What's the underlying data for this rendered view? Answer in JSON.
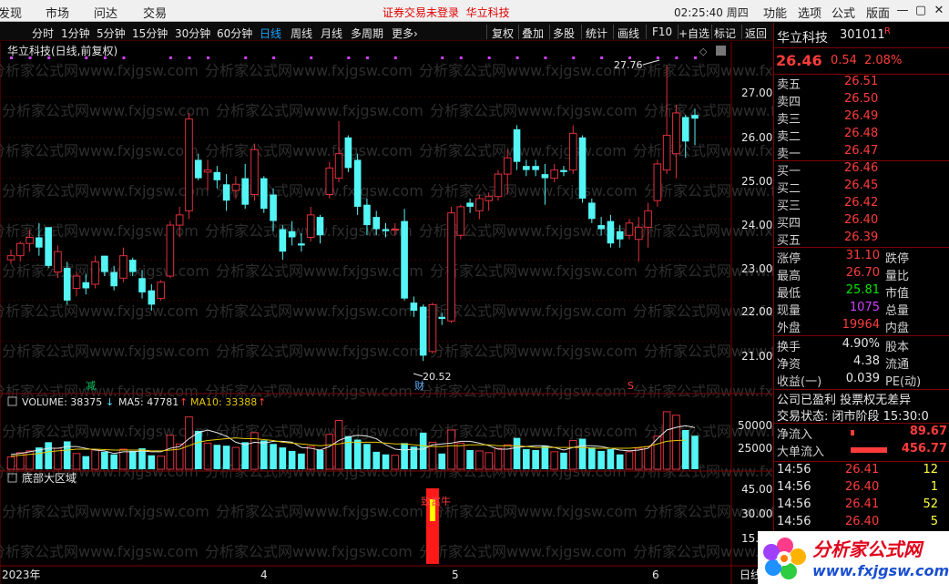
{
  "menu": {
    "items": [
      "发现",
      "市场",
      "问达",
      "交易"
    ],
    "status_text": "证券交易未登录",
    "status_stock": "华立科技",
    "clock": "02:25:40 周四",
    "right": [
      "功能",
      "选项",
      "公式",
      "版面"
    ],
    "window_controls": [
      "—",
      "▢",
      "✕"
    ]
  },
  "toolbar": {
    "timeframes": [
      "分时",
      "1分钟",
      "5分钟",
      "15分钟",
      "30分钟",
      "60分钟",
      "日线",
      "周线",
      "月线",
      "多周期",
      "更多›"
    ],
    "active": "日线",
    "buttons": [
      "复权",
      "叠加",
      "多股",
      "统计",
      "画线",
      "F10",
      "+自选",
      "标记",
      "返回"
    ]
  },
  "chart": {
    "title": "华立科技(日线,前复权)",
    "price_ticks": [
      "27.00",
      "26.00",
      "25.00",
      "24.00",
      "23.00",
      "22.00",
      "21.00"
    ],
    "high_label": "27.76",
    "low_label": "20.52",
    "mark_jian": "减",
    "mark_cai": "财",
    "mark_s": "S",
    "volume_label": "VOLUME: 38375",
    "ma5_label": "MA5: 47781",
    "ma10_label": "MA10: 33388",
    "volume_ticks": [
      "50000",
      "25000"
    ],
    "indicator_title": "底部大区域",
    "indicator_ticks": [
      "45.00",
      "30.00",
      "15.00"
    ],
    "indicator_signal": "致富牛",
    "date_labels": [
      "2023年",
      "4",
      "5",
      "6"
    ],
    "date_right": "日线",
    "watermark": "分析家公式网www.fxjgsw.com",
    "colors": {
      "up": "#e0303c",
      "down": "#54f5f5",
      "ma5": "#e6e6e6",
      "ma10": "#e6c800",
      "border": "#800000"
    }
  },
  "chart_data": {
    "type": "candlestick",
    "title": "华立科技(日线,前复权)",
    "ylim": [
      20.3,
      27.85
    ],
    "candles": [
      {
        "o": 23.0,
        "h": 23.25,
        "l": 22.9,
        "c": 23.1,
        "v": 14000
      },
      {
        "o": 23.1,
        "h": 23.45,
        "l": 22.95,
        "c": 23.4,
        "v": 19000
      },
      {
        "o": 23.4,
        "h": 23.75,
        "l": 23.2,
        "c": 23.55,
        "v": 21000
      },
      {
        "o": 23.55,
        "h": 23.9,
        "l": 23.1,
        "c": 23.3,
        "v": 25000
      },
      {
        "o": 23.8,
        "h": 23.8,
        "l": 22.8,
        "c": 22.85,
        "v": 31000
      },
      {
        "o": 22.7,
        "h": 23.35,
        "l": 22.55,
        "c": 23.2,
        "v": 24000
      },
      {
        "o": 22.8,
        "h": 22.95,
        "l": 21.9,
        "c": 22.0,
        "v": 32000
      },
      {
        "o": 22.3,
        "h": 22.7,
        "l": 22.1,
        "c": 22.6,
        "v": 18000
      },
      {
        "o": 22.45,
        "h": 22.65,
        "l": 22.15,
        "c": 22.3,
        "v": 15000
      },
      {
        "o": 22.4,
        "h": 23.1,
        "l": 22.3,
        "c": 22.95,
        "v": 22000
      },
      {
        "o": 23.1,
        "h": 23.1,
        "l": 22.6,
        "c": 22.7,
        "v": 20000
      },
      {
        "o": 22.7,
        "h": 22.85,
        "l": 22.25,
        "c": 22.35,
        "v": 17000
      },
      {
        "o": 22.55,
        "h": 23.3,
        "l": 22.45,
        "c": 23.1,
        "v": 23000
      },
      {
        "o": 23.0,
        "h": 23.05,
        "l": 22.6,
        "c": 22.7,
        "v": 21000
      },
      {
        "o": 22.55,
        "h": 22.75,
        "l": 22.05,
        "c": 22.2,
        "v": 24000
      },
      {
        "o": 22.25,
        "h": 22.4,
        "l": 21.75,
        "c": 21.9,
        "v": 16000
      },
      {
        "o": 22.05,
        "h": 22.5,
        "l": 22.0,
        "c": 22.45,
        "v": 15000
      },
      {
        "o": 22.6,
        "h": 23.95,
        "l": 22.55,
        "c": 23.85,
        "v": 39000
      },
      {
        "o": 23.85,
        "h": 24.3,
        "l": 23.55,
        "c": 24.1,
        "v": 29000
      },
      {
        "o": 24.2,
        "h": 26.6,
        "l": 24.0,
        "c": 26.45,
        "v": 60000
      },
      {
        "o": 25.45,
        "h": 25.6,
        "l": 24.95,
        "c": 25.0,
        "v": 44000
      },
      {
        "o": 25.15,
        "h": 25.45,
        "l": 24.7,
        "c": 25.2,
        "v": 30000
      },
      {
        "o": 25.15,
        "h": 25.3,
        "l": 24.75,
        "c": 24.95,
        "v": 28000
      },
      {
        "o": 24.85,
        "h": 25.1,
        "l": 24.2,
        "c": 24.45,
        "v": 27000
      },
      {
        "o": 24.7,
        "h": 25.05,
        "l": 24.5,
        "c": 24.85,
        "v": 25000
      },
      {
        "o": 25.0,
        "h": 25.35,
        "l": 24.25,
        "c": 24.35,
        "v": 31000
      },
      {
        "o": 24.6,
        "h": 25.85,
        "l": 24.45,
        "c": 25.7,
        "v": 42000
      },
      {
        "o": 25.0,
        "h": 25.05,
        "l": 24.15,
        "c": 24.25,
        "v": 33000
      },
      {
        "o": 24.6,
        "h": 24.75,
        "l": 23.7,
        "c": 23.95,
        "v": 29000
      },
      {
        "o": 23.75,
        "h": 23.85,
        "l": 23.0,
        "c": 23.2,
        "v": 25000
      },
      {
        "o": 23.7,
        "h": 23.95,
        "l": 23.35,
        "c": 23.55,
        "v": 21000
      },
      {
        "o": 23.4,
        "h": 23.65,
        "l": 23.2,
        "c": 23.35,
        "v": 18000
      },
      {
        "o": 23.55,
        "h": 24.3,
        "l": 23.45,
        "c": 24.1,
        "v": 26000
      },
      {
        "o": 24.05,
        "h": 24.1,
        "l": 23.4,
        "c": 23.6,
        "v": 22000
      },
      {
        "o": 24.6,
        "h": 25.4,
        "l": 24.5,
        "c": 25.25,
        "v": 40000
      },
      {
        "o": 25.0,
        "h": 26.4,
        "l": 24.9,
        "c": 25.6,
        "v": 56000
      },
      {
        "o": 26.0,
        "h": 26.05,
        "l": 25.15,
        "c": 25.25,
        "v": 38000
      },
      {
        "o": 25.45,
        "h": 25.6,
        "l": 24.1,
        "c": 24.3,
        "v": 34000
      },
      {
        "o": 24.35,
        "h": 24.5,
        "l": 23.6,
        "c": 23.85,
        "v": 29000
      },
      {
        "o": 24.05,
        "h": 24.2,
        "l": 23.6,
        "c": 23.75,
        "v": 20000
      },
      {
        "o": 23.75,
        "h": 23.9,
        "l": 23.55,
        "c": 23.7,
        "v": 17000
      },
      {
        "o": 23.75,
        "h": 23.9,
        "l": 23.6,
        "c": 23.75,
        "v": 16000
      },
      {
        "o": 23.95,
        "h": 24.25,
        "l": 22.0,
        "c": 22.05,
        "v": 30000
      },
      {
        "o": 21.95,
        "h": 22.1,
        "l": 21.6,
        "c": 21.75,
        "v": 26000
      },
      {
        "o": 21.85,
        "h": 21.9,
        "l": 20.52,
        "c": 20.65,
        "v": 42000
      },
      {
        "o": 20.75,
        "h": 21.95,
        "l": 20.7,
        "c": 21.9,
        "v": 31000
      },
      {
        "o": 21.6,
        "h": 21.7,
        "l": 21.4,
        "c": 21.55,
        "v": 18000
      },
      {
        "o": 21.5,
        "h": 24.3,
        "l": 21.45,
        "c": 24.15,
        "v": 45000
      },
      {
        "o": 23.6,
        "h": 24.35,
        "l": 23.5,
        "c": 24.3,
        "v": 30000
      },
      {
        "o": 24.4,
        "h": 24.5,
        "l": 24.15,
        "c": 24.3,
        "v": 22000
      },
      {
        "o": 24.2,
        "h": 24.6,
        "l": 24.0,
        "c": 24.5,
        "v": 21000
      },
      {
        "o": 24.45,
        "h": 24.65,
        "l": 24.2,
        "c": 24.55,
        "v": 19000
      },
      {
        "o": 24.55,
        "h": 25.2,
        "l": 24.45,
        "c": 25.1,
        "v": 24000
      },
      {
        "o": 25.1,
        "h": 25.7,
        "l": 24.6,
        "c": 25.5,
        "v": 28000
      },
      {
        "o": 26.2,
        "h": 26.3,
        "l": 25.2,
        "c": 25.4,
        "v": 36000
      },
      {
        "o": 25.3,
        "h": 25.45,
        "l": 25.05,
        "c": 25.2,
        "v": 23000
      },
      {
        "o": 25.3,
        "h": 25.45,
        "l": 25.05,
        "c": 25.2,
        "v": 22000
      },
      {
        "o": 25.1,
        "h": 25.35,
        "l": 24.35,
        "c": 25.0,
        "v": 27000
      },
      {
        "o": 25.0,
        "h": 25.35,
        "l": 24.9,
        "c": 25.2,
        "v": 20000
      },
      {
        "o": 25.2,
        "h": 25.3,
        "l": 25.05,
        "c": 25.15,
        "v": 19000
      },
      {
        "o": 25.2,
        "h": 26.3,
        "l": 25.1,
        "c": 26.1,
        "v": 33000
      },
      {
        "o": 26.0,
        "h": 26.05,
        "l": 24.4,
        "c": 24.5,
        "v": 35000
      },
      {
        "o": 24.4,
        "h": 24.5,
        "l": 23.9,
        "c": 24.0,
        "v": 25000
      },
      {
        "o": 23.85,
        "h": 24.05,
        "l": 23.6,
        "c": 23.75,
        "v": 21000
      },
      {
        "o": 23.95,
        "h": 24.1,
        "l": 23.3,
        "c": 23.4,
        "v": 23000
      },
      {
        "o": 23.7,
        "h": 23.85,
        "l": 23.3,
        "c": 23.5,
        "v": 17000
      },
      {
        "o": 23.6,
        "h": 24.0,
        "l": 23.5,
        "c": 23.9,
        "v": 20000
      },
      {
        "o": 23.5,
        "h": 24.05,
        "l": 22.95,
        "c": 23.8,
        "v": 24000
      },
      {
        "o": 23.8,
        "h": 24.4,
        "l": 23.3,
        "c": 24.2,
        "v": 26000
      },
      {
        "o": 24.45,
        "h": 25.45,
        "l": 24.3,
        "c": 25.35,
        "v": 38000
      },
      {
        "o": 25.2,
        "h": 27.76,
        "l": 25.1,
        "c": 26.05,
        "v": 66000
      },
      {
        "o": 25.6,
        "h": 26.8,
        "l": 25.0,
        "c": 26.6,
        "v": 62000
      },
      {
        "o": 26.5,
        "h": 26.55,
        "l": 25.5,
        "c": 25.9,
        "v": 45000
      },
      {
        "o": 26.55,
        "h": 26.7,
        "l": 25.81,
        "c": 26.46,
        "v": 38375
      }
    ],
    "ma5": [
      17000,
      18000,
      20000,
      22000,
      24000,
      24000,
      26000,
      26000,
      24000,
      22000,
      21000,
      18000,
      20000,
      20000,
      21000,
      20000,
      20000,
      24000,
      26000,
      35000,
      42000,
      45000,
      42000,
      38000,
      31000,
      28000,
      31000,
      30000,
      32000,
      32000,
      31000,
      25000,
      24000,
      22000,
      26000,
      33000,
      37000,
      39000,
      38000,
      35000,
      28000,
      23000,
      22000,
      23000,
      23000,
      28000,
      29000,
      30000,
      32000,
      32000,
      30000,
      27000,
      23000,
      23000,
      25000,
      26000,
      27000,
      27000,
      25000,
      22000,
      25000,
      27000,
      27000,
      26000,
      24000,
      22000,
      21000,
      22000,
      24000,
      35000,
      45000,
      48000,
      50000,
      47781
    ],
    "ma10": [
      15000,
      16000,
      17000,
      18000,
      20000,
      21000,
      22000,
      23000,
      23000,
      23000,
      22500,
      22000,
      22000,
      22000,
      22000,
      21000,
      21000,
      22000,
      23000,
      27000,
      31000,
      33000,
      34000,
      35000,
      36000,
      35000,
      35000,
      34000,
      33000,
      31000,
      30000,
      29000,
      28000,
      27000,
      28000,
      29000,
      31000,
      31000,
      31000,
      31000,
      30000,
      29000,
      29000,
      28000,
      27000,
      26000,
      26000,
      27000,
      27000,
      28000,
      28000,
      28000,
      27000,
      27000,
      27000,
      26000,
      25000,
      25000,
      25000,
      25000,
      25000,
      25000,
      24000,
      24000,
      24000,
      24000,
      24000,
      25000,
      26000,
      29000,
      32000,
      33000,
      33388
    ],
    "indicator_signal": {
      "index": 45,
      "value": 30
    }
  },
  "quote": {
    "name": "华立科技",
    "code": "301011",
    "code_flag": "R",
    "price": "26.46",
    "change": "0.54",
    "pct": "2.08%",
    "asks": [
      {
        "label": "卖五",
        "price": "26.51"
      },
      {
        "label": "卖四",
        "price": "26.50"
      },
      {
        "label": "卖三",
        "price": "26.49"
      },
      {
        "label": "卖二",
        "price": "26.48"
      },
      {
        "label": "卖一",
        "price": "26.47"
      }
    ],
    "bids": [
      {
        "label": "买一",
        "price": "26.46"
      },
      {
        "label": "买二",
        "price": "26.45"
      },
      {
        "label": "买三",
        "price": "26.42"
      },
      {
        "label": "买四",
        "price": "26.40"
      },
      {
        "label": "买五",
        "price": "26.39"
      }
    ],
    "stats": [
      {
        "l1": "涨停",
        "v1": "31.10",
        "c1": "red",
        "l2": "跌停"
      },
      {
        "l1": "最高",
        "v1": "26.70",
        "c1": "red",
        "l2": "量比"
      },
      {
        "l1": "最低",
        "v1": "25.81",
        "c1": "green",
        "l2": "市值"
      },
      {
        "l1": "现量",
        "v1": "1075",
        "c1": "purple",
        "l2": "总量"
      },
      {
        "l1": "外盘",
        "v1": "19964",
        "c1": "red",
        "l2": "内盘"
      }
    ],
    "fundamentals": [
      {
        "l1": "换手",
        "v1": "4.90%",
        "l2": "股本"
      },
      {
        "l1": "净资",
        "v1": "4.38",
        "l2": "流通"
      },
      {
        "l1": "收益(一)",
        "v1": "0.039",
        "l2": "PE(动)"
      }
    ],
    "info1": "公司已盈利 投票权无差异",
    "info2": "交易状态: 闭市阶段 15:30:0",
    "flows": [
      {
        "label": "净流入",
        "value": "89.67",
        "bar": 0.08
      },
      {
        "label": "大单流入",
        "value": "456.77",
        "bar": 0.9
      }
    ],
    "ticks": [
      {
        "time": "14:56",
        "price": "26.41",
        "vol": "12"
      },
      {
        "time": "14:56",
        "price": "26.40",
        "vol": "1"
      },
      {
        "time": "14:56",
        "price": "26.41",
        "vol": "52"
      },
      {
        "time": "14:56",
        "price": "26.40",
        "vol": "5"
      }
    ]
  },
  "logo": {
    "name": "分析家公式网",
    "url": "www.fxjgsw.com"
  }
}
